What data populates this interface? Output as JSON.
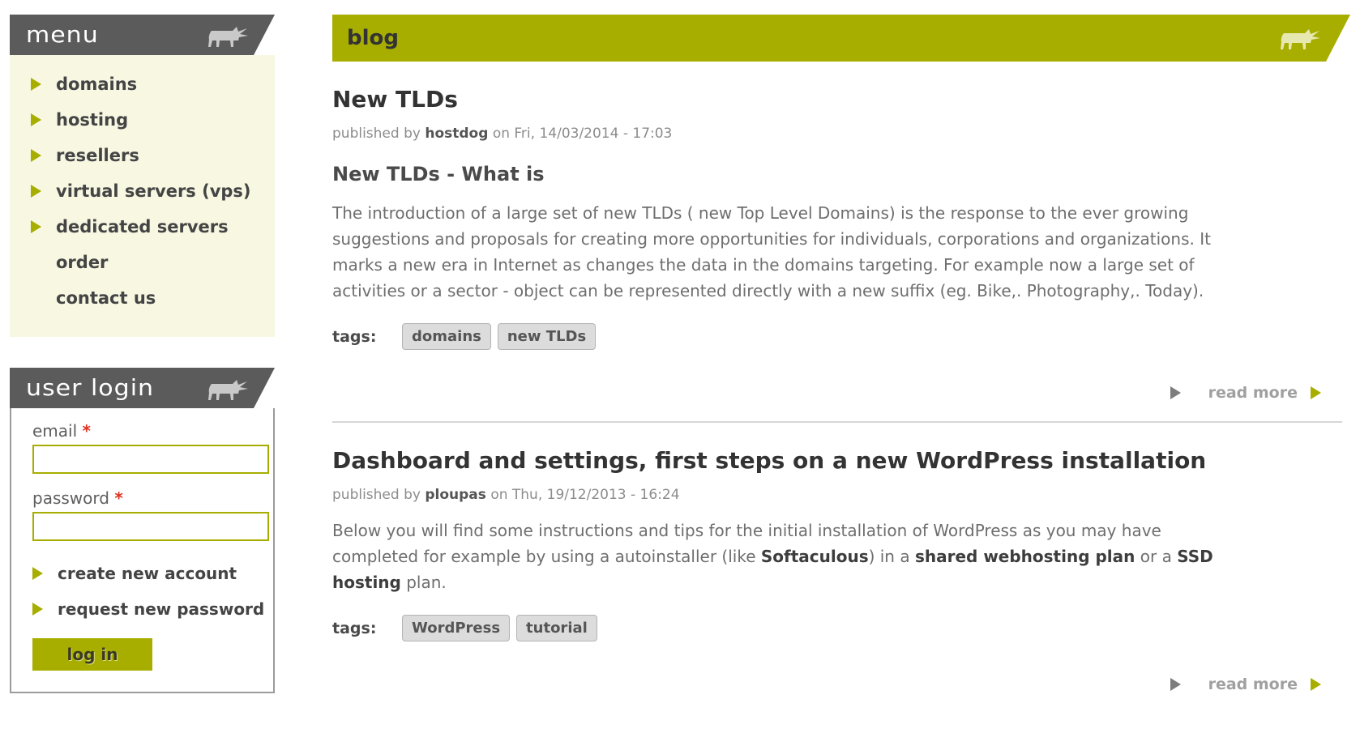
{
  "sidebar": {
    "menu_block": {
      "title": "menu",
      "icon": "dog-icon",
      "items": [
        {
          "label": "domains",
          "bullet": true
        },
        {
          "label": "hosting",
          "bullet": true
        },
        {
          "label": "resellers",
          "bullet": true
        },
        {
          "label": "virtual servers (vps)",
          "bullet": true
        },
        {
          "label": "dedicated servers",
          "bullet": true
        },
        {
          "label": "order",
          "bullet": false
        },
        {
          "label": "contact us",
          "bullet": false
        }
      ]
    },
    "login_block": {
      "title": "user login",
      "icon": "dog-icon",
      "email_label": "email",
      "email_required_mark": "*",
      "email_value": "",
      "password_label": "password",
      "password_required_mark": "*",
      "password_value": "",
      "links": [
        {
          "label": "create new account"
        },
        {
          "label": "request new password"
        }
      ],
      "submit_label": "log in"
    }
  },
  "main": {
    "header_title": "blog",
    "header_icon": "dog-icon",
    "articles": [
      {
        "title": "New TLDs",
        "meta_prefix": "published by",
        "author": "hostdog",
        "meta_suffix": "on Fri, 14/03/2014 - 17:03",
        "subheading": "New TLDs - What is",
        "body": "The introduction of a large set of new TLDs ( new Top Level Domains) is the response to the ever growing suggestions and proposals for creating more opportunities for individuals, corporations and organizations. It marks a new era in Internet as changes the data in the domains targeting. For example now a large set of activities or a sector - object can be represented directly with a new suffix (eg. Bike,. Photography,. Today).",
        "tags_label": "tags:",
        "tags": [
          "domains",
          "new TLDs"
        ],
        "read_more": "read more"
      },
      {
        "title": "Dashboard and settings, first steps on a new WordPress installation",
        "meta_prefix": "published by",
        "author": "ploupas",
        "meta_suffix": "on Thu, 19/12/2013 - 16:24",
        "subheading": "",
        "body_parts": [
          {
            "text": "Below you will find some instructions and tips for the initial installation of WordPress as you may have completed for example by using a autoinstaller (like ",
            "bold": false
          },
          {
            "text": "Softaculous",
            "bold": true
          },
          {
            "text": ") in a ",
            "bold": false
          },
          {
            "text": "shared webhosting plan",
            "bold": true
          },
          {
            "text": " or a ",
            "bold": false
          },
          {
            "text": "SSD hosting",
            "bold": true
          },
          {
            "text": " plan.",
            "bold": false
          }
        ],
        "tags_label": "tags:",
        "tags": [
          "WordPress",
          "tutorial"
        ],
        "read_more": "read more"
      }
    ]
  },
  "colors": {
    "accent_olive": "#a8ae00",
    "header_gray": "#5b5b5b",
    "menu_cream": "#f7f7e2",
    "text_gray": "#6e6e6e",
    "required_red": "#e03020",
    "tag_bg": "#dcdcdc"
  }
}
